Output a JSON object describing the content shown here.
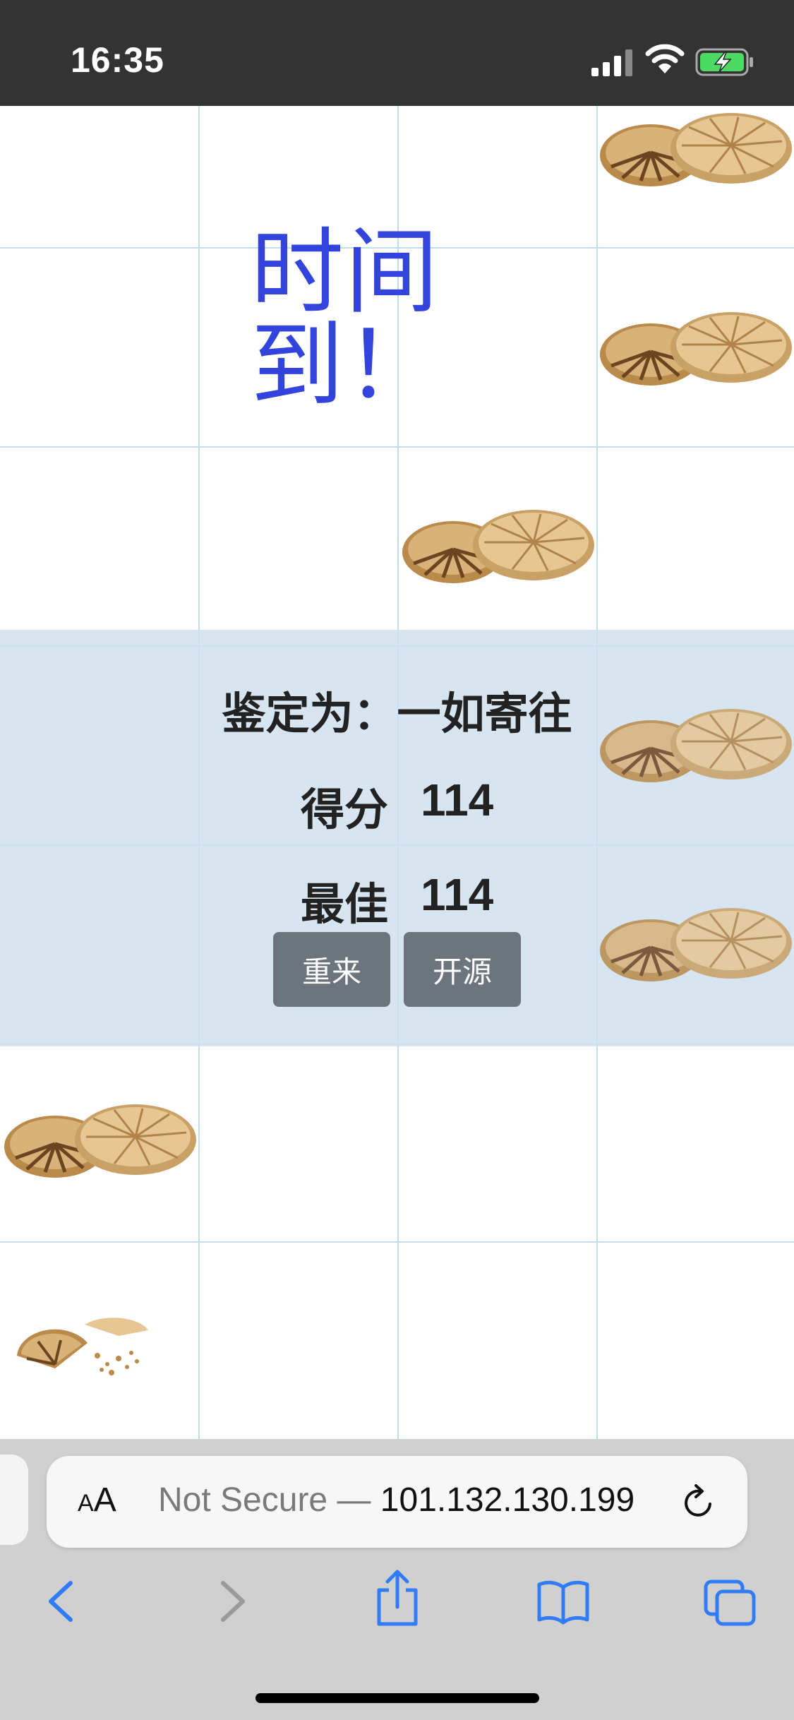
{
  "status_bar": {
    "time": "16:35"
  },
  "game": {
    "time_up_text": "时间到！",
    "verdict_label": "鉴定为：",
    "verdict_value": "一如寄往",
    "score_label": "得分",
    "score_value": "114",
    "best_label": "最佳",
    "best_value": "114",
    "restart_label": "重来",
    "source_label": "开源"
  },
  "browser": {
    "aa_label_small": "A",
    "aa_label_large": "A",
    "url_prefix": "Not Secure —",
    "url_host": "101.132.130.199"
  },
  "colors": {
    "time_up": "#3344dd",
    "button_bg": "#6c747d",
    "grid_line": "#bfdfe9",
    "accent_blue": "#2f7cf6"
  },
  "icons": [
    "cellular-signal-icon",
    "wifi-icon",
    "battery-charging-icon",
    "cookie-icon",
    "crumbs-icon",
    "reload-icon",
    "back-icon",
    "forward-icon",
    "share-icon",
    "bookmarks-icon",
    "tabs-icon"
  ]
}
